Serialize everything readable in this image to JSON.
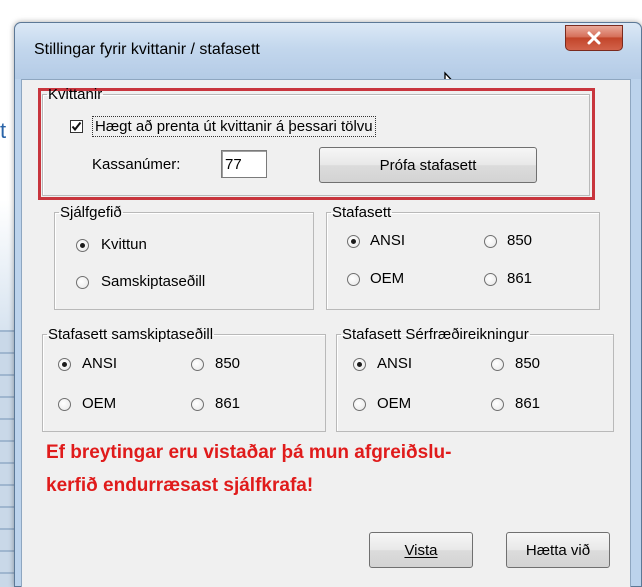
{
  "background": {
    "letter": "t"
  },
  "dialog": {
    "title": "Stillingar fyrir kvittanir / stafasett",
    "close_label": "x"
  },
  "kvittanir": {
    "legend": "Kvittanir",
    "checkbox_label": "Hægt að prenta út kvittanir á þessari tölvu",
    "checkbox_checked": true,
    "kassanumer_label": "Kassanúmer:",
    "kassanumer_value": "77",
    "test_button": "Prófa stafasett"
  },
  "sjalfgefid": {
    "legend": "Sjálfgefið",
    "options": [
      "Kvittun",
      "Samskiptaseðill"
    ],
    "selected": "Kvittun"
  },
  "stafasett": {
    "legend": "Stafasett",
    "options": [
      "ANSI",
      "850",
      "OEM",
      "861"
    ],
    "selected": "ANSI"
  },
  "stafasett_samskiptasedill": {
    "legend": "Stafasett samskiptaseðill",
    "options": [
      "ANSI",
      "850",
      "OEM",
      "861"
    ],
    "selected": "ANSI"
  },
  "stafasett_serfraedi": {
    "legend": "Stafasett Sérfræðireikningur",
    "options": [
      "ANSI",
      "850",
      "OEM",
      "861"
    ],
    "selected": "ANSI"
  },
  "warning": {
    "line1": "Ef breytingar eru vistaðar þá mun afgreiðslu-",
    "line2": "kerfið endurræsast sjálfkrafa!"
  },
  "buttons": {
    "save": "Vista",
    "cancel": "Hætta við"
  },
  "colors": {
    "warning": "#e01b1b",
    "highlight": "#c8353d",
    "close": "#c2452a"
  }
}
